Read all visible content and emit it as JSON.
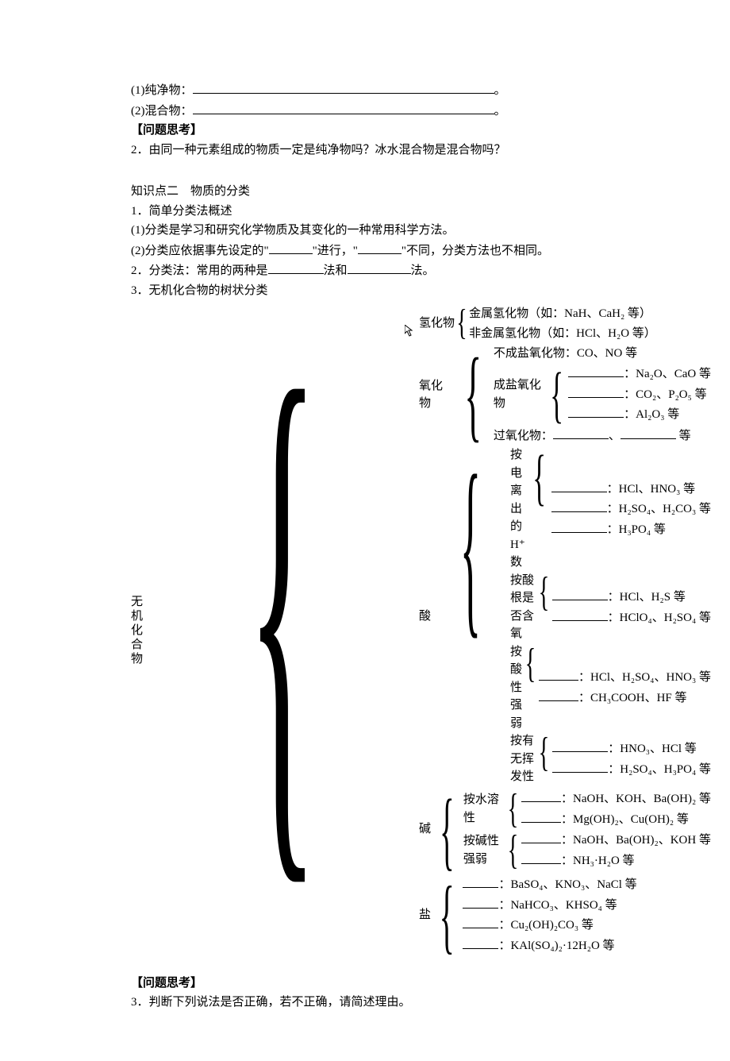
{
  "top": {
    "item1_prefix": "(1)纯净物：",
    "item1_suffix": "。",
    "item2_prefix": "(2)混合物：",
    "item2_suffix": "。",
    "think_header": "【问题思考】",
    "q2": "2．由同一种元素组成的物质一定是纯净物吗？冰水混合物是混合物吗？"
  },
  "kp2": {
    "title": "知识点二　物质的分类",
    "s1_title": "1．简单分类法概述",
    "s1_1": "(1)分类是学习和研究化学物质及其变化的一种常用科学方法。",
    "s1_2a": "(2)分类应依据事先设定的\"",
    "s1_2b": "\"进行，\"",
    "s1_2c": "\"不同，分类方法也不相同。",
    "s2a": "2．分类法：常用的两种是",
    "s2b": "法和",
    "s2c": "法。",
    "s3": "3．无机化合物的树状分类"
  },
  "tree": {
    "root": "无机化合物",
    "hydride": {
      "label": "氢化物",
      "a": "金属氢化物（如：NaH、CaH₂ 等）",
      "b": "非金属氢化物（如：HCl、H₂O 等）"
    },
    "oxide": {
      "label": "氧化物",
      "nosalt": "不成盐氧化物：CO、NO 等",
      "salt_label": "成盐氧化物",
      "salt_a_suffix": "：Na₂O、CaO 等",
      "salt_b_suffix": "：CO₂、P₂O₅ 等",
      "salt_c_suffix": "：Al₂O₃ 等",
      "peroxide_prefix": "过氧化物：",
      "peroxide_mid": "、",
      "peroxide_suffix": " 等"
    },
    "acid": {
      "label": "酸",
      "byH": {
        "label": "按电离出的 H⁺ 数",
        "a": "：HCl、HNO₃ 等",
        "b": "：H₂SO₄、H₂CO₃ 等",
        "c": "：H₃PO₄ 等"
      },
      "byO": {
        "label": "按酸根是否含氧",
        "a": "：HCl、H₂S 等",
        "b": "：HClO₄、H₂SO₄ 等"
      },
      "byStrength": {
        "label": "按酸性强弱",
        "a": "：HCl、H₂SO₄、HNO₃ 等",
        "b": "：CH₃COOH、HF 等"
      },
      "byVol": {
        "label": "按有无挥发性",
        "a": "：HNO₃、HCl 等",
        "b": "：H₂SO₄、H₃PO₄ 等"
      }
    },
    "base": {
      "label": "碱",
      "bySol": {
        "label": "按水溶性",
        "a": "：NaOH、KOH、Ba(OH)₂ 等",
        "b": "：Mg(OH)₂、Cu(OH)₂ 等"
      },
      "byStrength": {
        "label": "按碱性强弱",
        "a": "：NaOH、Ba(OH)₂、KOH 等",
        "b": "：NH₃·H₂O 等"
      }
    },
    "salt": {
      "label": "盐",
      "a": "：BaSO₄、KNO₃、NaCl 等",
      "b": "：NaHCO₃、KHSO₄ 等",
      "c": "：Cu₂(OH)₂CO₃ 等",
      "d": "：KAl(SO₄)₂·12H₂O 等"
    }
  },
  "bottom": {
    "think_header": "【问题思考】",
    "q3": "3．判断下列说法是否正确，若不正确，请简述理由。"
  }
}
